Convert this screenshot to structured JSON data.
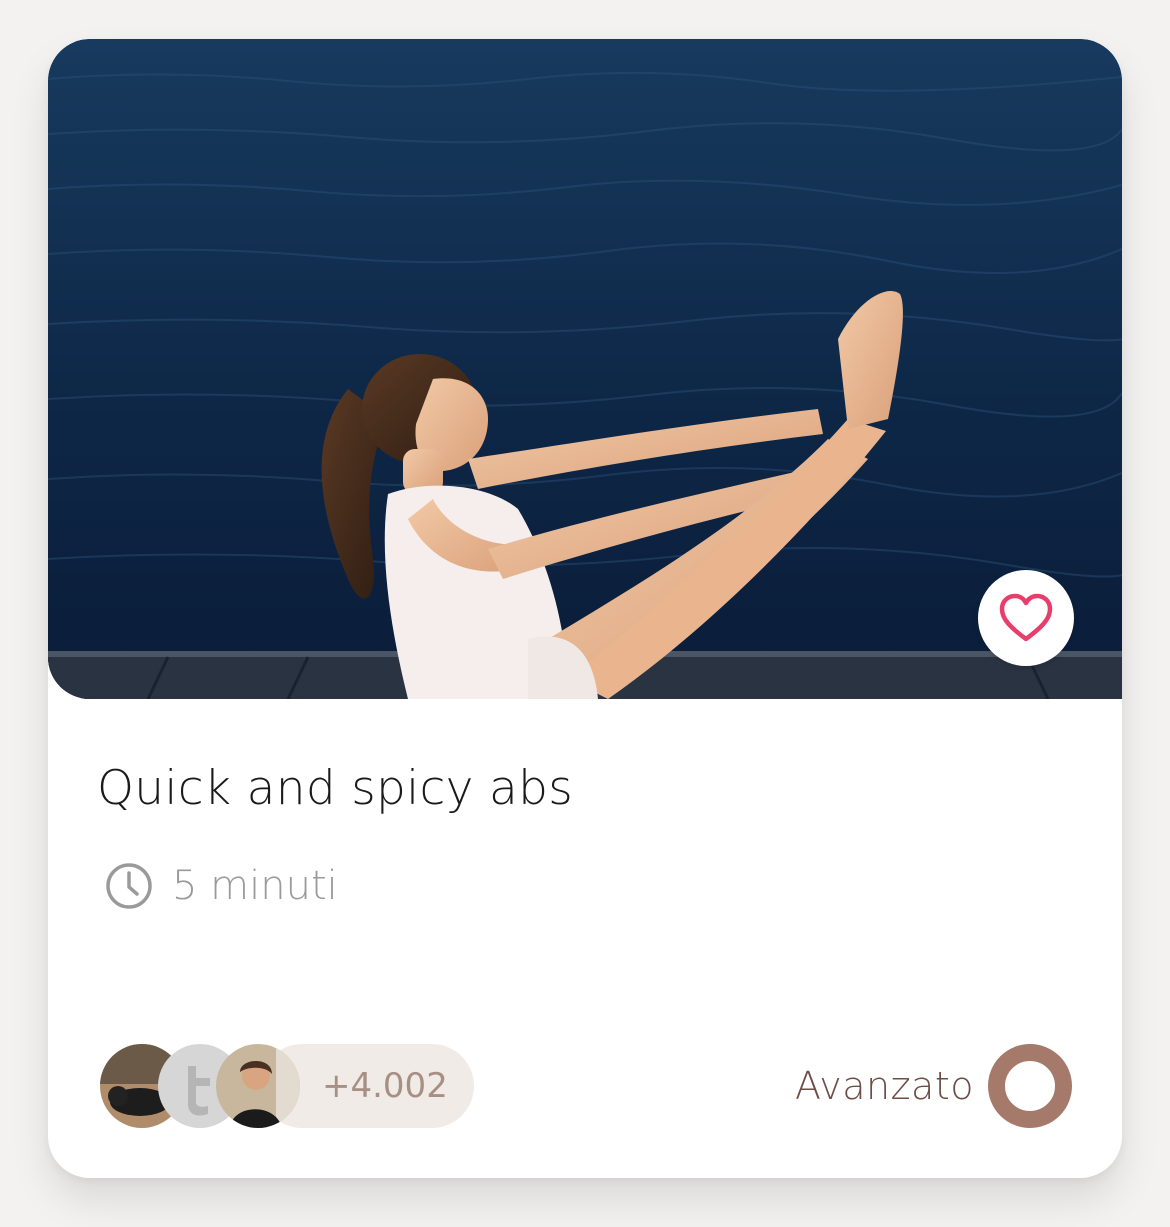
{
  "workout": {
    "title": "Quick and spicy abs",
    "duration": "5 minuti",
    "participants_extra": "+4.002",
    "level": "Avanzato"
  },
  "icons": {
    "favorite": "heart-outline-icon",
    "duration": "clock-icon",
    "level": "level-ring-icon"
  },
  "colors": {
    "favorite_heart": "#e83e6c",
    "level_ring": "#a57a6a",
    "level_text": "#6e4d45",
    "count_pill_bg": "#f1ebe7",
    "count_pill_text": "#a88f84"
  }
}
